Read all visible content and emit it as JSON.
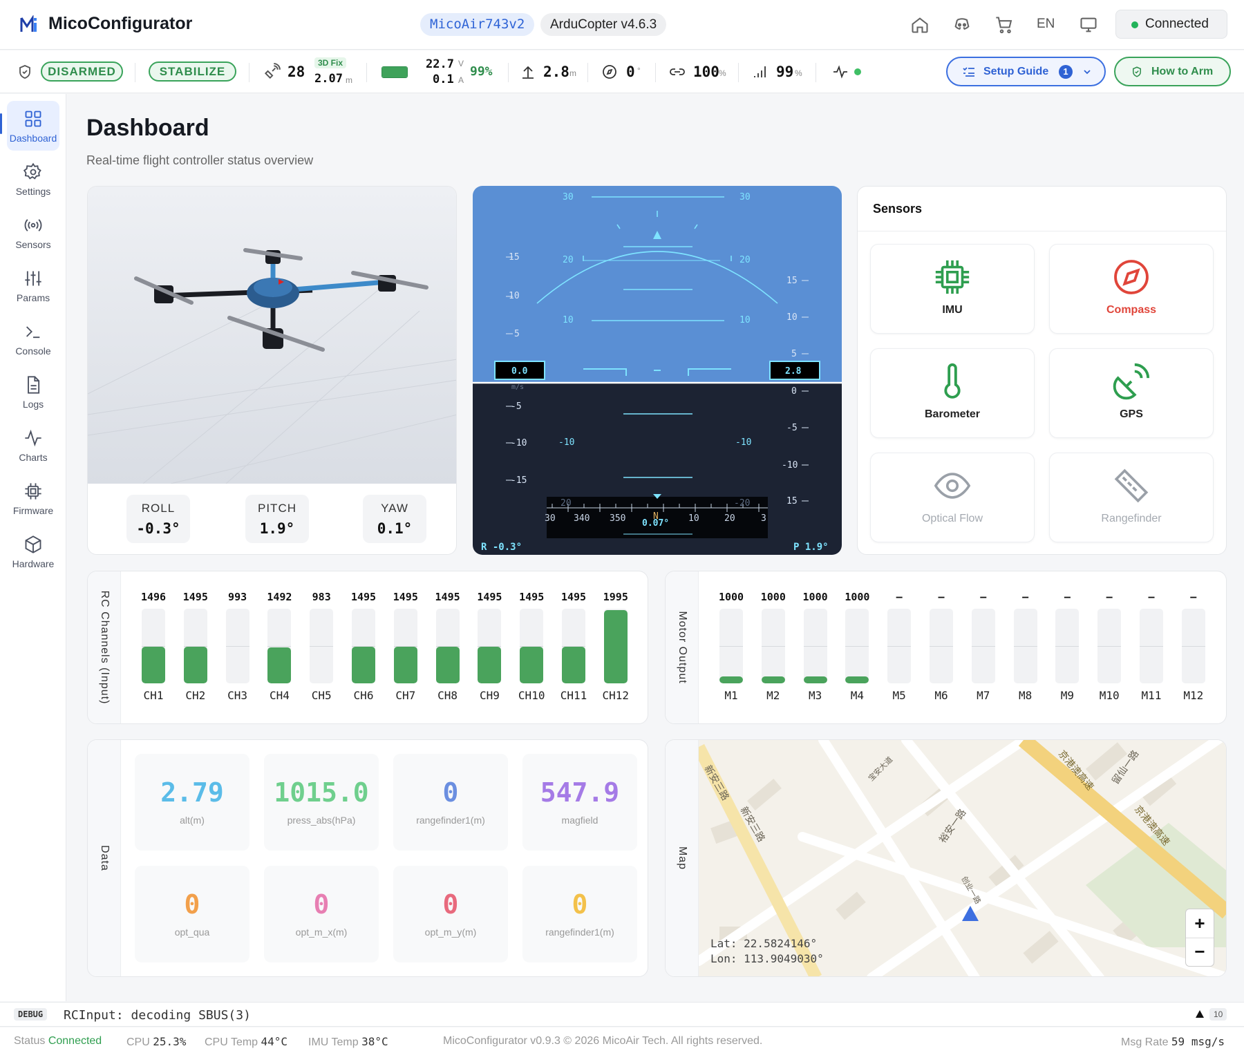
{
  "header": {
    "app_title": "MicoConfigurator",
    "board": "MicoAir743v2",
    "firmware": "ArduCopter v4.6.3",
    "language": "EN",
    "connection": "Connected",
    "icons": [
      "home-icon",
      "discord-icon",
      "cart-icon",
      "monitor-icon"
    ]
  },
  "status": {
    "arm_state": "DISARMED",
    "flight_mode": "STABILIZE",
    "satellites": "28",
    "gps_fix": "3D Fix",
    "hdop": "2.07",
    "hdop_unit": "m",
    "voltage": "22.7",
    "voltage_unit": "V",
    "current": "0.1",
    "current_unit": "A",
    "battery_pct": "99%",
    "battery_level": 0.99,
    "altitude": "2.8",
    "altitude_unit": "m",
    "heading": "0",
    "heading_unit": "°",
    "link_quality": "100",
    "link_unit": "%",
    "rssi": "99",
    "rssi_unit": "%",
    "setup_guide": "Setup Guide",
    "setup_guide_count": "1",
    "how_to_arm": "How to Arm"
  },
  "sidebar": {
    "items": [
      {
        "label": "Dashboard",
        "icon": "grid-icon",
        "active": true
      },
      {
        "label": "Settings",
        "icon": "gear-icon"
      },
      {
        "label": "Sensors",
        "icon": "broadcast-icon"
      },
      {
        "label": "Params",
        "icon": "sliders-icon"
      },
      {
        "label": "Console",
        "icon": "terminal-icon"
      },
      {
        "label": "Logs",
        "icon": "file-icon"
      },
      {
        "label": "Charts",
        "icon": "activity-icon"
      },
      {
        "label": "Firmware",
        "icon": "chip-icon"
      },
      {
        "label": "Hardware",
        "icon": "cube-icon"
      }
    ]
  },
  "page": {
    "title": "Dashboard",
    "subtitle": "Real-time flight controller status overview"
  },
  "attitude": {
    "roll_label": "ROLL",
    "roll": "-0.3°",
    "pitch_label": "PITCH",
    "pitch": "1.9°",
    "yaw_label": "YAW",
    "yaw": "0.1°"
  },
  "hud": {
    "speed": "0.0",
    "speed_unit": "m/s",
    "altitude": "2.8",
    "heading": "0.07°",
    "heading_marker": "N",
    "roll": "R -0.3°",
    "pitch": "P 1.9°",
    "pitch_ladder": [
      "30",
      "20",
      "10",
      "-10"
    ],
    "left_tape": [
      "15",
      "10",
      "5",
      "-5",
      "-10",
      "-15"
    ],
    "right_tape": [
      "15",
      "10",
      "5",
      "0",
      "-5",
      "-10",
      "15"
    ],
    "compass_ticks": [
      "30",
      "340",
      "350",
      "10",
      "20",
      "3"
    ],
    "roll_scale": [
      "20",
      "-20"
    ]
  },
  "sensors": {
    "title": "Sensors",
    "items": [
      {
        "label": "IMU",
        "icon": "chip-icon",
        "state": "ok",
        "color": "#2e9e4f"
      },
      {
        "label": "Compass",
        "icon": "compass-icon",
        "state": "error",
        "color": "#e0453a"
      },
      {
        "label": "Barometer",
        "icon": "thermometer-icon",
        "state": "ok",
        "color": "#2e9e4f"
      },
      {
        "label": "GPS",
        "icon": "satellite-icon",
        "state": "ok",
        "color": "#2e9e4f"
      },
      {
        "label": "Optical Flow",
        "icon": "eye-icon",
        "state": "inactive",
        "color": "#9aa0a8"
      },
      {
        "label": "Rangefinder",
        "icon": "ruler-icon",
        "state": "inactive",
        "color": "#9aa0a8"
      }
    ]
  },
  "rc": {
    "title": "RC Channels (Input)",
    "channels": [
      {
        "label": "CH1",
        "value": "1496",
        "level": 0.5
      },
      {
        "label": "CH2",
        "value": "1495",
        "level": 0.5
      },
      {
        "label": "CH3",
        "value": "993",
        "level": 0.0
      },
      {
        "label": "CH4",
        "value": "1492",
        "level": 0.49
      },
      {
        "label": "CH5",
        "value": "983",
        "level": 0.0
      },
      {
        "label": "CH6",
        "value": "1495",
        "level": 0.5
      },
      {
        "label": "CH7",
        "value": "1495",
        "level": 0.5
      },
      {
        "label": "CH8",
        "value": "1495",
        "level": 0.5
      },
      {
        "label": "CH9",
        "value": "1495",
        "level": 0.5
      },
      {
        "label": "CH10",
        "value": "1495",
        "level": 0.5
      },
      {
        "label": "CH11",
        "value": "1495",
        "level": 0.5
      },
      {
        "label": "CH12",
        "value": "1995",
        "level": 1.0
      }
    ]
  },
  "motors": {
    "title": "Motor Output",
    "channels": [
      {
        "label": "M1",
        "value": "1000",
        "level": 0.08
      },
      {
        "label": "M2",
        "value": "1000",
        "level": 0.08
      },
      {
        "label": "M3",
        "value": "1000",
        "level": 0.08
      },
      {
        "label": "M4",
        "value": "1000",
        "level": 0.08
      },
      {
        "label": "M5",
        "value": "–",
        "level": 0
      },
      {
        "label": "M6",
        "value": "–",
        "level": 0
      },
      {
        "label": "M7",
        "value": "–",
        "level": 0
      },
      {
        "label": "M8",
        "value": "–",
        "level": 0
      },
      {
        "label": "M9",
        "value": "–",
        "level": 0
      },
      {
        "label": "M10",
        "value": "–",
        "level": 0
      },
      {
        "label": "M11",
        "value": "–",
        "level": 0
      },
      {
        "label": "M12",
        "value": "–",
        "level": 0
      }
    ]
  },
  "data_panel": {
    "title": "Data",
    "tiles": [
      {
        "value": "2.79",
        "label": "alt(m)",
        "color": "#5bbce8"
      },
      {
        "value": "1015.0",
        "label": "press_abs(hPa)",
        "color": "#6fcf8d"
      },
      {
        "value": "0",
        "label": "rangefinder1(m)",
        "color": "#6b8fe0"
      },
      {
        "value": "547.9",
        "label": "magfield",
        "color": "#a57be6"
      },
      {
        "value": "0",
        "label": "opt_qua",
        "color": "#f2a04b"
      },
      {
        "value": "0",
        "label": "opt_m_x(m)",
        "color": "#e77fb2"
      },
      {
        "value": "0",
        "label": "opt_m_y(m)",
        "color": "#e86a7d"
      },
      {
        "value": "0",
        "label": "rangefinder1(m)",
        "color": "#f3c14a"
      }
    ]
  },
  "map": {
    "title": "Map",
    "lat": "Lat: 22.5824146°",
    "lon": "Lon: 113.9049030°",
    "zoom_in": "+",
    "zoom_out": "−",
    "roads": [
      "新安三路",
      "新安三路",
      "裕安一路",
      "宝安大道",
      "留仙一路",
      "京港澳高速",
      "京港澳高速",
      "创业一路"
    ]
  },
  "debug": {
    "level": "DEBUG",
    "message": "RCInput: decoding SBUS(3)",
    "count": "10"
  },
  "footer": {
    "status_label": "Status",
    "status": "Connected",
    "cpu_label": "CPU",
    "cpu": "25.3%",
    "cpu_temp_label": "CPU Temp",
    "cpu_temp": "44°C",
    "imu_temp_label": "IMU Temp",
    "imu_temp": "38°C",
    "copyright": "MicoConfigurator v0.9.3 © 2026 MicoAir Tech. All rights reserved.",
    "msg_rate_label": "Msg Rate",
    "msg_rate": "59 msg/s"
  }
}
